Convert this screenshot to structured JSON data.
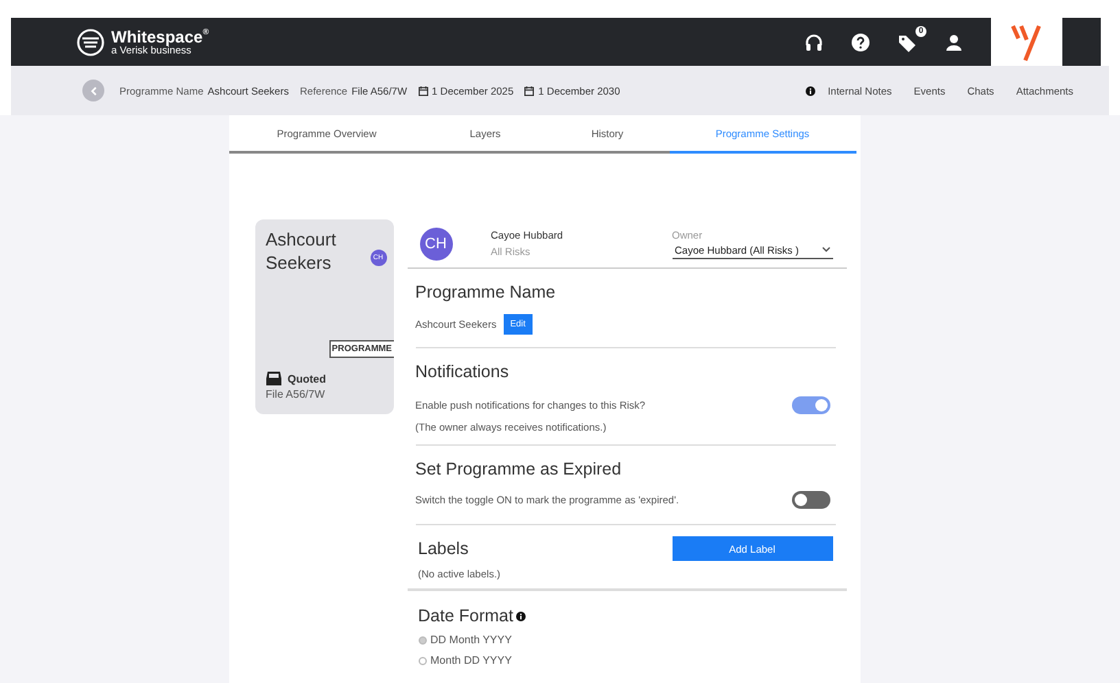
{
  "header": {
    "brand": "Whitespace",
    "brand_mark": "®",
    "tagline": "a Verisk business",
    "notification_count": "0"
  },
  "subbar": {
    "items": [
      {
        "label": "Programme Name",
        "value": "Ashcourt Seekers",
        "kind": "field"
      },
      {
        "label": "Reference",
        "value": "File A56/7W",
        "kind": "field"
      },
      {
        "value": "1 December 2025",
        "kind": "date"
      },
      {
        "value": "1 December 2030",
        "kind": "date"
      }
    ],
    "links": [
      {
        "label": "Internal Notes",
        "kind": "notes"
      },
      {
        "label": "Events",
        "kind": "plain"
      },
      {
        "label": "Chats",
        "kind": "plain"
      },
      {
        "label": "Attachments",
        "kind": "plain"
      }
    ]
  },
  "tabs": [
    {
      "label": "Programme Overview",
      "selected": false
    },
    {
      "label": "Layers",
      "selected": false
    },
    {
      "label": "History",
      "selected": false
    },
    {
      "label": "Programme Settings",
      "selected": true
    }
  ],
  "card": {
    "title": "Ashcourt Seekers",
    "initials": "CH",
    "tag": "PROGRAMME",
    "status": "Quoted",
    "file": "File A56/7W"
  },
  "owner": {
    "initials": "CH",
    "name": "Cayoe Hubbard",
    "team": "All Risks",
    "label": "Owner",
    "value": "Cayoe Hubbard (All Risks )"
  },
  "programme_name": {
    "heading": "Programme Name",
    "value": "Ashcourt Seekers",
    "button": "Edit"
  },
  "notifications": {
    "heading": "Notifications",
    "text": "Enable push notifications for changes to this Risk?",
    "on": true,
    "note": "(The owner always receives notifications.)"
  },
  "expired": {
    "heading": "Set Programme as Expired",
    "text": "Switch the toggle ON to mark the programme as 'expired'.",
    "on": false
  },
  "labels": {
    "heading": "Labels",
    "button": "Add Label",
    "empty": "(No active labels.)"
  },
  "date_format": {
    "heading": "Date Format",
    "options": [
      {
        "label": "DD Month YYYY",
        "selected": true
      },
      {
        "label": "Month DD YYYY",
        "selected": false
      }
    ]
  }
}
